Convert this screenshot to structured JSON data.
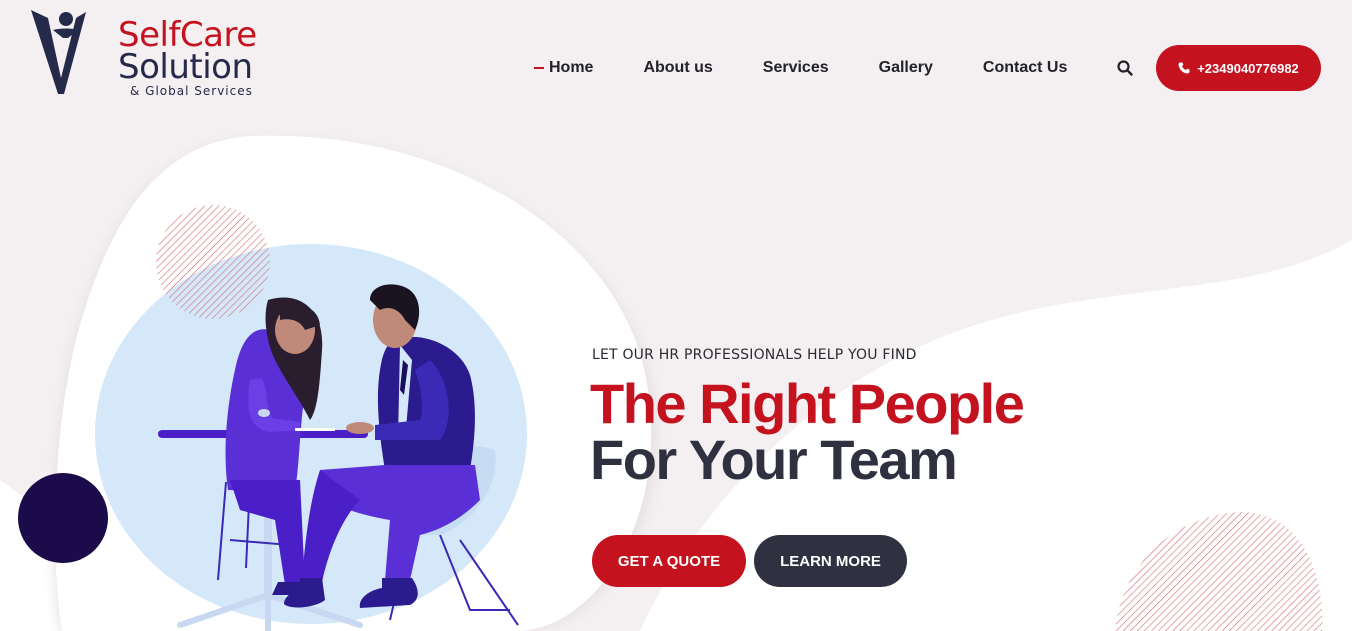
{
  "logo": {
    "line1": "SelfCare",
    "line2": "Solution",
    "line3": "& Global Services"
  },
  "nav": {
    "items": [
      {
        "label": "Home",
        "active": true
      },
      {
        "label": "About us",
        "active": false
      },
      {
        "label": "Services",
        "active": false
      },
      {
        "label": "Gallery",
        "active": false
      },
      {
        "label": "Contact Us",
        "active": false
      }
    ]
  },
  "header": {
    "phone": "+2349040776982",
    "search_icon": "search-icon",
    "phone_icon": "phone-icon"
  },
  "hero": {
    "subtitle": "LET OUR HR PROFESSIONALS HELP YOU FIND",
    "headline_1": "The Right People",
    "headline_2": "For Your Team",
    "primary_button": "GET A QUOTE",
    "secondary_button": "LEARN MORE"
  },
  "colors": {
    "brand_red": "#c4121f",
    "brand_dark": "#2f3040",
    "background": "#f4f0f1"
  }
}
